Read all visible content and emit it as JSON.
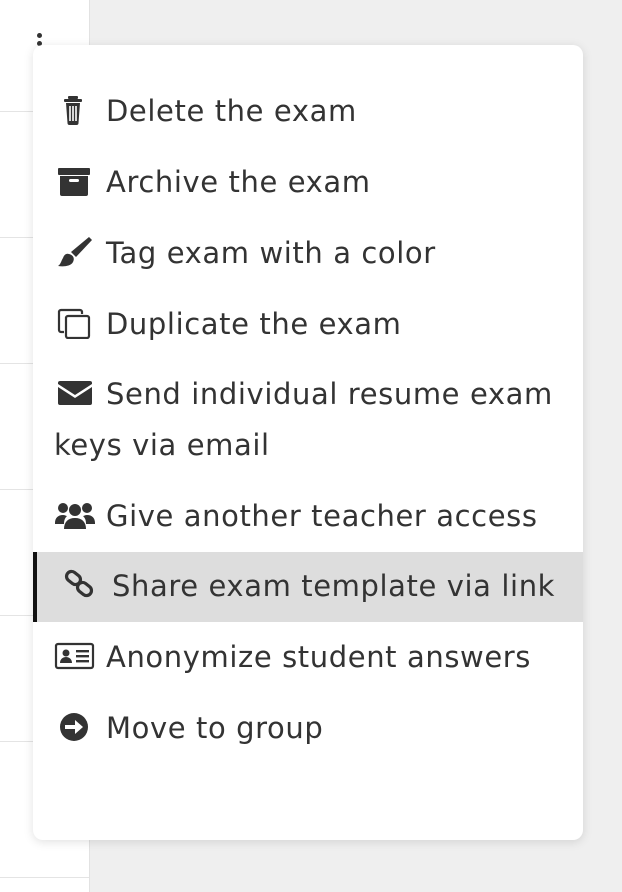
{
  "menu": {
    "items": [
      {
        "label": "Delete the exam",
        "icon": "trash-icon"
      },
      {
        "label": "Archive the exam",
        "icon": "archive-box-icon"
      },
      {
        "label": "Tag exam with a color",
        "icon": "paint-brush-icon"
      },
      {
        "label": "Duplicate the exam",
        "icon": "copy-icon"
      },
      {
        "label": "Send individual resume exam keys via email",
        "icon": "envelope-icon"
      },
      {
        "label": "Give another teacher access",
        "icon": "users-icon"
      },
      {
        "label": "Share exam template via link",
        "icon": "link-icon",
        "active": true
      },
      {
        "label": "Anonymize student answers",
        "icon": "id-card-icon"
      },
      {
        "label": "Move to group",
        "icon": "arrow-circle-right-icon"
      }
    ]
  },
  "colors": {
    "text": "#333333",
    "active_bg": "#dddddd",
    "active_border": "#111111",
    "backdrop": "#efefef"
  }
}
